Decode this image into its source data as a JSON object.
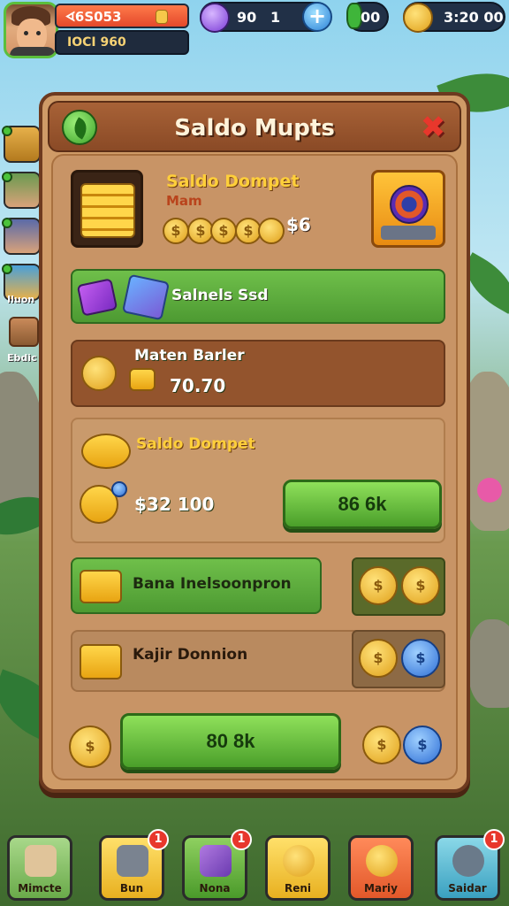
{
  "hud": {
    "player_name": "ᗏ6S053",
    "player_level": "IOCI 960",
    "gems": "90",
    "gems_secondary": "1",
    "green_currency": "00",
    "coins": "3:20 00"
  },
  "side": {
    "items": [
      {
        "icon": "crate-icon"
      },
      {
        "icon": "character-avatar-icon"
      },
      {
        "icon": "character-avatar-icon"
      },
      {
        "icon": "character-avatar-icon",
        "label": "Iluon"
      },
      {
        "icon": "box-icon",
        "label": "Ebdic"
      }
    ]
  },
  "panel": {
    "title": "Saldo Mupts",
    "top_card": {
      "title": "Saldo Dompet",
      "subtitle": "Mam",
      "amount": "$6",
      "coin_glyph": "$"
    },
    "sainels": {
      "label": "Salnels Ssd"
    },
    "maten": {
      "title": "Maten Barler",
      "value": "70.70"
    },
    "saldo": {
      "title": "Saldo Dompet",
      "amount": "$32 100",
      "button": "86 6k"
    },
    "bana": {
      "label": "Bana Inelsoonpron"
    },
    "kajir": {
      "label": "Kajir Donnion"
    },
    "bottom_button": "80 8k"
  },
  "nav": {
    "items": [
      {
        "label": "Mimcte",
        "badge": ""
      },
      {
        "label": "Bun",
        "badge": "1"
      },
      {
        "label": "Nona",
        "badge": "1"
      },
      {
        "label": "Reni",
        "badge": ""
      },
      {
        "label": "Mariy",
        "badge": ""
      },
      {
        "label": "Saidar",
        "badge": "1"
      }
    ]
  },
  "colors": {
    "panel": "#cf9b67",
    "panel_border": "#6d3a1f",
    "accent_green": "#4d9a32",
    "gold": "#ffcf3a",
    "badge_red": "#e8372c"
  }
}
